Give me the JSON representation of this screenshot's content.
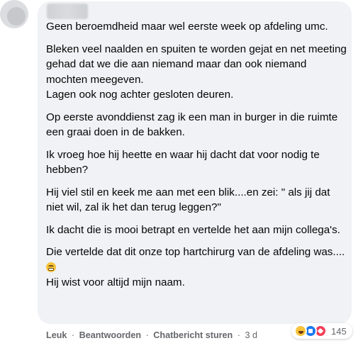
{
  "comment": {
    "lines": [
      "Geen beroemdheid maar wel eerste week op afdeling umc.",
      "Bleken veel naalden en spuiten te worden gejat en net meeting gehad dat we die aan niemand maar dan ook niemand mochten meegeven.\nLagen ook nog achter gesloten deuren.",
      "Op eerste avonddienst zag ik een man in burger in die ruimte een graai doen in de bakken.",
      "Ik vroeg hoe hij heette en waar hij dacht dat voor nodig te hebben?",
      "Hij viel stil en keek me aan met een blik....en zei: \" als jij dat niet wil, zal ik het dan terug leggen?\"",
      "Ik dacht die is mooi betrapt en vertelde het aan mijn collega's.",
      "Die vertelde dat dit onze top hartchirurg van de afdeling was....",
      "Hij wist voor altijd mijn naam."
    ],
    "emoji_icon": "grinning-face-emoji"
  },
  "actions": {
    "like": "Leuk",
    "reply": "Beantwoorden",
    "message": "Chatbericht sturen",
    "separator": "·",
    "time": "3 d"
  },
  "reactions": {
    "icons": [
      "haha-reaction-icon",
      "like-reaction-icon",
      "love-reaction-icon"
    ],
    "count": "145"
  },
  "colors": {
    "bubble": "#f0f2f5",
    "text": "#050505",
    "secondary": "#65676b",
    "like_blue": "#1877f2",
    "love_red": "#f33e58",
    "haha_yellow": "#f7c33a"
  }
}
